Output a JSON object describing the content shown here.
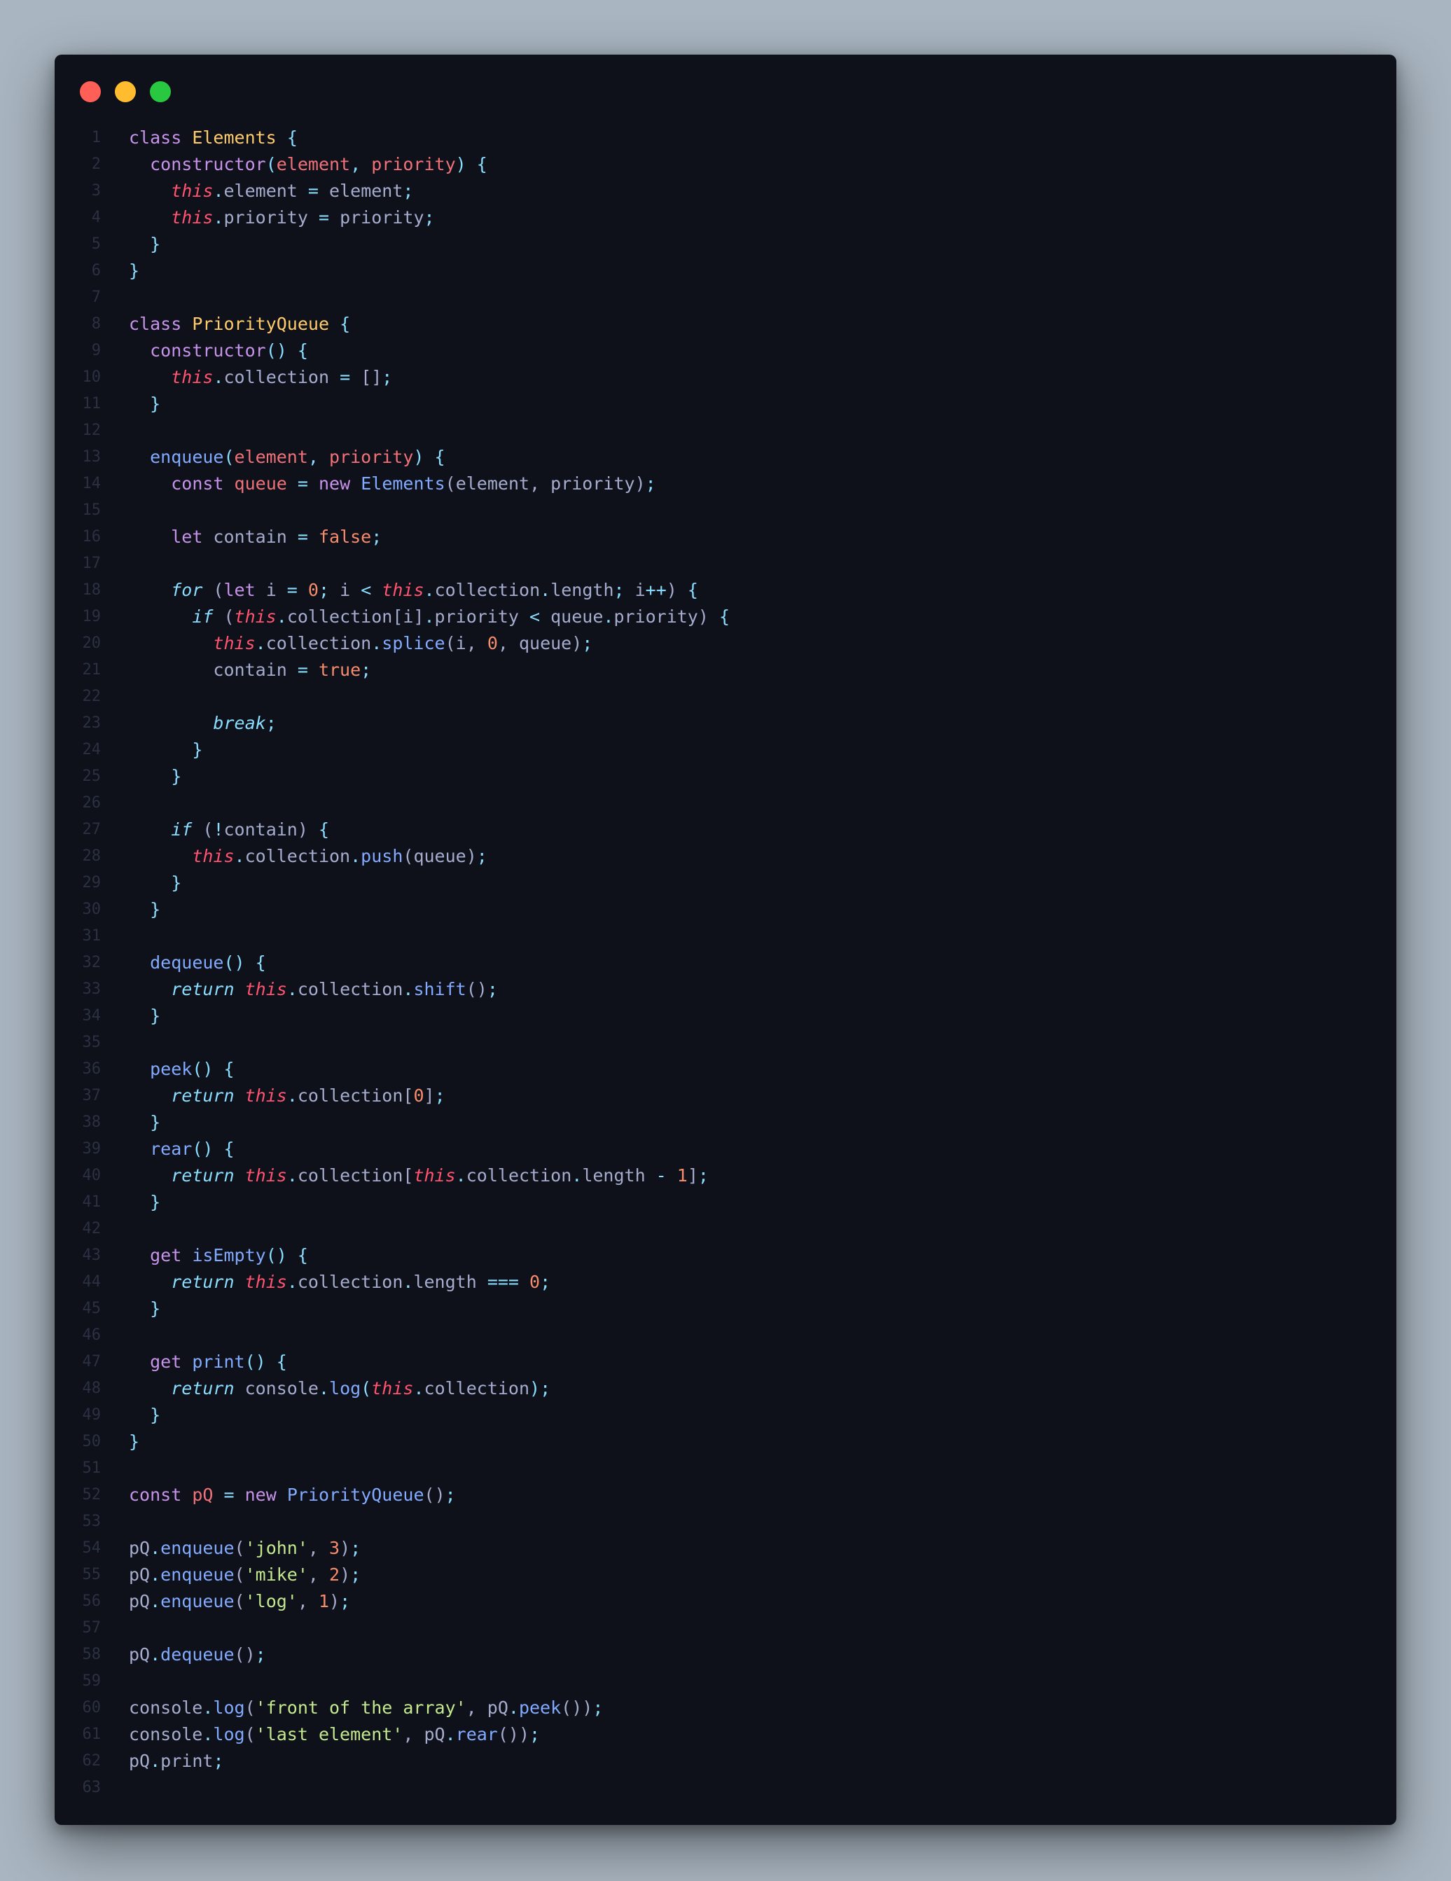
{
  "window": {
    "controls": [
      {
        "name": "close",
        "color": "#ff5f57"
      },
      {
        "name": "minimize",
        "color": "#febc2e"
      },
      {
        "name": "maximize",
        "color": "#28c840"
      }
    ]
  },
  "colors": {
    "background": "#a9b5c0",
    "editor": "#0e111a",
    "keyword": "#c792ea",
    "class": "#ffcb6b",
    "punctuation": "#89ddff",
    "parameter": "#f07178",
    "this": "#ff5370",
    "number": "#f78c6c",
    "string": "#c3e88d",
    "function": "#82aaff",
    "plain": "#a6accd",
    "line_number": "#2b3142"
  },
  "code": {
    "language": "javascript",
    "lines": [
      [
        [
          "kw",
          "class"
        ],
        [
          "pl",
          " "
        ],
        [
          "cls",
          "Elements"
        ],
        [
          "pl",
          " "
        ],
        [
          "p",
          "{"
        ]
      ],
      [
        [
          "pl",
          "  "
        ],
        [
          "kw",
          "constructor"
        ],
        [
          "p",
          "("
        ],
        [
          "param",
          "element"
        ],
        [
          "p",
          ", "
        ],
        [
          "param",
          "priority"
        ],
        [
          "p",
          ")"
        ],
        [
          "pl",
          " "
        ],
        [
          "p",
          "{"
        ]
      ],
      [
        [
          "pl",
          "    "
        ],
        [
          "this",
          "this"
        ],
        [
          "p",
          "."
        ],
        [
          "pl",
          "element "
        ],
        [
          "p",
          "="
        ],
        [
          "pl",
          " element"
        ],
        [
          "p",
          ";"
        ]
      ],
      [
        [
          "pl",
          "    "
        ],
        [
          "this",
          "this"
        ],
        [
          "p",
          "."
        ],
        [
          "pl",
          "priority "
        ],
        [
          "p",
          "="
        ],
        [
          "pl",
          " priority"
        ],
        [
          "p",
          ";"
        ]
      ],
      [
        [
          "pl",
          "  "
        ],
        [
          "p",
          "}"
        ]
      ],
      [
        [
          "p",
          "}"
        ]
      ],
      [],
      [
        [
          "kw",
          "class"
        ],
        [
          "pl",
          " "
        ],
        [
          "cls",
          "PriorityQueue"
        ],
        [
          "pl",
          " "
        ],
        [
          "p",
          "{"
        ]
      ],
      [
        [
          "pl",
          "  "
        ],
        [
          "kw",
          "constructor"
        ],
        [
          "p",
          "()"
        ],
        [
          "pl",
          " "
        ],
        [
          "p",
          "{"
        ]
      ],
      [
        [
          "pl",
          "    "
        ],
        [
          "this",
          "this"
        ],
        [
          "p",
          "."
        ],
        [
          "pl",
          "collection "
        ],
        [
          "p",
          "="
        ],
        [
          "pl",
          " []"
        ],
        [
          "p",
          ";"
        ]
      ],
      [
        [
          "pl",
          "  "
        ],
        [
          "p",
          "}"
        ]
      ],
      [],
      [
        [
          "pl",
          "  "
        ],
        [
          "fn",
          "enqueue"
        ],
        [
          "p",
          "("
        ],
        [
          "param",
          "element"
        ],
        [
          "p",
          ", "
        ],
        [
          "param",
          "priority"
        ],
        [
          "p",
          ")"
        ],
        [
          "pl",
          " "
        ],
        [
          "p",
          "{"
        ]
      ],
      [
        [
          "pl",
          "    "
        ],
        [
          "kw",
          "const"
        ],
        [
          "pl",
          " "
        ],
        [
          "var",
          "queue"
        ],
        [
          "pl",
          " "
        ],
        [
          "p",
          "="
        ],
        [
          "pl",
          " "
        ],
        [
          "kw",
          "new"
        ],
        [
          "pl",
          " "
        ],
        [
          "fn",
          "Elements"
        ],
        [
          "pl",
          "(element, priority)"
        ],
        [
          "p",
          ";"
        ]
      ],
      [],
      [
        [
          "pl",
          "    "
        ],
        [
          "kw",
          "let"
        ],
        [
          "pl",
          " contain "
        ],
        [
          "p",
          "="
        ],
        [
          "pl",
          " "
        ],
        [
          "num",
          "false"
        ],
        [
          "p",
          ";"
        ]
      ],
      [],
      [
        [
          "pl",
          "    "
        ],
        [
          "flow",
          "for"
        ],
        [
          "pl",
          " ("
        ],
        [
          "kw",
          "let"
        ],
        [
          "pl",
          " i "
        ],
        [
          "p",
          "="
        ],
        [
          "pl",
          " "
        ],
        [
          "num",
          "0"
        ],
        [
          "p",
          ";"
        ],
        [
          "pl",
          " i "
        ],
        [
          "p",
          "<"
        ],
        [
          "pl",
          " "
        ],
        [
          "this",
          "this"
        ],
        [
          "p",
          "."
        ],
        [
          "pl",
          "collection"
        ],
        [
          "p",
          "."
        ],
        [
          "pl",
          "length"
        ],
        [
          "p",
          ";"
        ],
        [
          "pl",
          " i"
        ],
        [
          "p",
          "++"
        ],
        [
          "pl",
          ") "
        ],
        [
          "p",
          "{"
        ]
      ],
      [
        [
          "pl",
          "      "
        ],
        [
          "flow",
          "if"
        ],
        [
          "pl",
          " ("
        ],
        [
          "this",
          "this"
        ],
        [
          "p",
          "."
        ],
        [
          "pl",
          "collection[i]"
        ],
        [
          "p",
          "."
        ],
        [
          "pl",
          "priority "
        ],
        [
          "p",
          "<"
        ],
        [
          "pl",
          " queue"
        ],
        [
          "p",
          "."
        ],
        [
          "pl",
          "priority) "
        ],
        [
          "p",
          "{"
        ]
      ],
      [
        [
          "pl",
          "        "
        ],
        [
          "this",
          "this"
        ],
        [
          "p",
          "."
        ],
        [
          "pl",
          "collection"
        ],
        [
          "p",
          "."
        ],
        [
          "fn",
          "splice"
        ],
        [
          "pl",
          "(i, "
        ],
        [
          "num",
          "0"
        ],
        [
          "pl",
          ", queue)"
        ],
        [
          "p",
          ";"
        ]
      ],
      [
        [
          "pl",
          "        contain "
        ],
        [
          "p",
          "="
        ],
        [
          "pl",
          " "
        ],
        [
          "num",
          "true"
        ],
        [
          "p",
          ";"
        ]
      ],
      [],
      [
        [
          "pl",
          "        "
        ],
        [
          "flow",
          "break"
        ],
        [
          "p",
          ";"
        ]
      ],
      [
        [
          "pl",
          "      "
        ],
        [
          "p",
          "}"
        ]
      ],
      [
        [
          "pl",
          "    "
        ],
        [
          "p",
          "}"
        ]
      ],
      [],
      [
        [
          "pl",
          "    "
        ],
        [
          "flow",
          "if"
        ],
        [
          "pl",
          " ("
        ],
        [
          "p",
          "!"
        ],
        [
          "pl",
          "contain) "
        ],
        [
          "p",
          "{"
        ]
      ],
      [
        [
          "pl",
          "      "
        ],
        [
          "this",
          "this"
        ],
        [
          "p",
          "."
        ],
        [
          "pl",
          "collection"
        ],
        [
          "p",
          "."
        ],
        [
          "fn",
          "push"
        ],
        [
          "pl",
          "(queue)"
        ],
        [
          "p",
          ";"
        ]
      ],
      [
        [
          "pl",
          "    "
        ],
        [
          "p",
          "}"
        ]
      ],
      [
        [
          "pl",
          "  "
        ],
        [
          "p",
          "}"
        ]
      ],
      [],
      [
        [
          "pl",
          "  "
        ],
        [
          "fn",
          "dequeue"
        ],
        [
          "p",
          "()"
        ],
        [
          "pl",
          " "
        ],
        [
          "p",
          "{"
        ]
      ],
      [
        [
          "pl",
          "    "
        ],
        [
          "flow",
          "return"
        ],
        [
          "pl",
          " "
        ],
        [
          "this",
          "this"
        ],
        [
          "p",
          "."
        ],
        [
          "pl",
          "collection"
        ],
        [
          "p",
          "."
        ],
        [
          "fn",
          "shift"
        ],
        [
          "pl",
          "()"
        ],
        [
          "p",
          ";"
        ]
      ],
      [
        [
          "pl",
          "  "
        ],
        [
          "p",
          "}"
        ]
      ],
      [],
      [
        [
          "pl",
          "  "
        ],
        [
          "fn",
          "peek"
        ],
        [
          "p",
          "()"
        ],
        [
          "pl",
          " "
        ],
        [
          "p",
          "{"
        ]
      ],
      [
        [
          "pl",
          "    "
        ],
        [
          "flow",
          "return"
        ],
        [
          "pl",
          " "
        ],
        [
          "this",
          "this"
        ],
        [
          "p",
          "."
        ],
        [
          "pl",
          "collection["
        ],
        [
          "num",
          "0"
        ],
        [
          "pl",
          "]"
        ],
        [
          "p",
          ";"
        ]
      ],
      [
        [
          "pl",
          "  "
        ],
        [
          "p",
          "}"
        ]
      ],
      [
        [
          "pl",
          "  "
        ],
        [
          "fn",
          "rear"
        ],
        [
          "p",
          "()"
        ],
        [
          "pl",
          " "
        ],
        [
          "p",
          "{"
        ]
      ],
      [
        [
          "pl",
          "    "
        ],
        [
          "flow",
          "return"
        ],
        [
          "pl",
          " "
        ],
        [
          "this",
          "this"
        ],
        [
          "p",
          "."
        ],
        [
          "pl",
          "collection["
        ],
        [
          "this",
          "this"
        ],
        [
          "p",
          "."
        ],
        [
          "pl",
          "collection"
        ],
        [
          "p",
          "."
        ],
        [
          "pl",
          "length "
        ],
        [
          "p",
          "-"
        ],
        [
          "pl",
          " "
        ],
        [
          "num",
          "1"
        ],
        [
          "pl",
          "]"
        ],
        [
          "p",
          ";"
        ]
      ],
      [
        [
          "pl",
          "  "
        ],
        [
          "p",
          "}"
        ]
      ],
      [],
      [
        [
          "pl",
          "  "
        ],
        [
          "kw",
          "get"
        ],
        [
          "pl",
          " "
        ],
        [
          "fn",
          "isEmpty"
        ],
        [
          "p",
          "()"
        ],
        [
          "pl",
          " "
        ],
        [
          "p",
          "{"
        ]
      ],
      [
        [
          "pl",
          "    "
        ],
        [
          "flow",
          "return"
        ],
        [
          "pl",
          " "
        ],
        [
          "this",
          "this"
        ],
        [
          "p",
          "."
        ],
        [
          "pl",
          "collection"
        ],
        [
          "p",
          "."
        ],
        [
          "pl",
          "length "
        ],
        [
          "p",
          "==="
        ],
        [
          "pl",
          " "
        ],
        [
          "num",
          "0"
        ],
        [
          "p",
          ";"
        ]
      ],
      [
        [
          "pl",
          "  "
        ],
        [
          "p",
          "}"
        ]
      ],
      [],
      [
        [
          "pl",
          "  "
        ],
        [
          "kw",
          "get"
        ],
        [
          "pl",
          " "
        ],
        [
          "fn",
          "print"
        ],
        [
          "p",
          "()"
        ],
        [
          "pl",
          " "
        ],
        [
          "p",
          "{"
        ]
      ],
      [
        [
          "pl",
          "    "
        ],
        [
          "flow",
          "return"
        ],
        [
          "pl",
          " console"
        ],
        [
          "p",
          "."
        ],
        [
          "fn",
          "log"
        ],
        [
          "p",
          "("
        ],
        [
          "this",
          "this"
        ],
        [
          "p",
          "."
        ],
        [
          "pl",
          "collection"
        ],
        [
          "p",
          ")"
        ],
        [
          "p",
          ";"
        ]
      ],
      [
        [
          "pl",
          "  "
        ],
        [
          "p",
          "}"
        ]
      ],
      [
        [
          "p",
          "}"
        ]
      ],
      [],
      [
        [
          "kw",
          "const"
        ],
        [
          "pl",
          " "
        ],
        [
          "var",
          "pQ"
        ],
        [
          "pl",
          " "
        ],
        [
          "p",
          "="
        ],
        [
          "pl",
          " "
        ],
        [
          "kw",
          "new"
        ],
        [
          "pl",
          " "
        ],
        [
          "fn",
          "PriorityQueue"
        ],
        [
          "pl",
          "()"
        ],
        [
          "p",
          ";"
        ]
      ],
      [],
      [
        [
          "pl",
          "pQ"
        ],
        [
          "p",
          "."
        ],
        [
          "fn",
          "enqueue"
        ],
        [
          "pl",
          "("
        ],
        [
          "str",
          "'john'"
        ],
        [
          "pl",
          ", "
        ],
        [
          "num",
          "3"
        ],
        [
          "pl",
          ")"
        ],
        [
          "p",
          ";"
        ]
      ],
      [
        [
          "pl",
          "pQ"
        ],
        [
          "p",
          "."
        ],
        [
          "fn",
          "enqueue"
        ],
        [
          "pl",
          "("
        ],
        [
          "str",
          "'mike'"
        ],
        [
          "pl",
          ", "
        ],
        [
          "num",
          "2"
        ],
        [
          "pl",
          ")"
        ],
        [
          "p",
          ";"
        ]
      ],
      [
        [
          "pl",
          "pQ"
        ],
        [
          "p",
          "."
        ],
        [
          "fn",
          "enqueue"
        ],
        [
          "pl",
          "("
        ],
        [
          "str",
          "'log'"
        ],
        [
          "pl",
          ", "
        ],
        [
          "num",
          "1"
        ],
        [
          "pl",
          ")"
        ],
        [
          "p",
          ";"
        ]
      ],
      [],
      [
        [
          "pl",
          "pQ"
        ],
        [
          "p",
          "."
        ],
        [
          "fn",
          "dequeue"
        ],
        [
          "pl",
          "()"
        ],
        [
          "p",
          ";"
        ]
      ],
      [],
      [
        [
          "pl",
          "console"
        ],
        [
          "p",
          "."
        ],
        [
          "fn",
          "log"
        ],
        [
          "pl",
          "("
        ],
        [
          "str",
          "'front of the array'"
        ],
        [
          "pl",
          ", pQ"
        ],
        [
          "p",
          "."
        ],
        [
          "fn",
          "peek"
        ],
        [
          "pl",
          "())"
        ],
        [
          "p",
          ";"
        ]
      ],
      [
        [
          "pl",
          "console"
        ],
        [
          "p",
          "."
        ],
        [
          "fn",
          "log"
        ],
        [
          "pl",
          "("
        ],
        [
          "str",
          "'last element'"
        ],
        [
          "pl",
          ", pQ"
        ],
        [
          "p",
          "."
        ],
        [
          "fn",
          "rear"
        ],
        [
          "pl",
          "())"
        ],
        [
          "p",
          ";"
        ]
      ],
      [
        [
          "pl",
          "pQ"
        ],
        [
          "p",
          "."
        ],
        [
          "pl",
          "print"
        ],
        [
          "p",
          ";"
        ]
      ],
      []
    ]
  }
}
